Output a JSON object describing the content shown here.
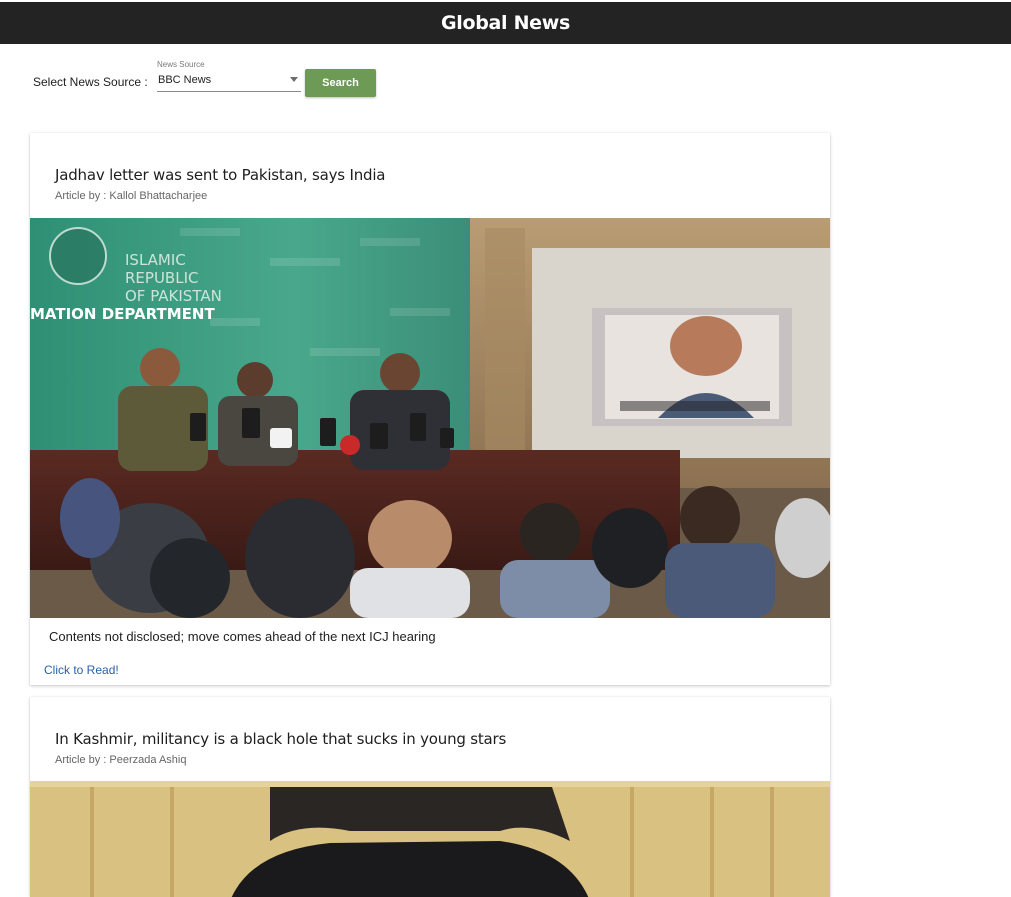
{
  "header": {
    "title": "Global News"
  },
  "toolbar": {
    "select_label": "Select News Source :",
    "source_field_label": "News Source",
    "source_value": "BBC News",
    "search_label": "Search"
  },
  "articles": [
    {
      "title": "Jadhav letter was sent to Pakistan, says India",
      "author": "Article by : Kallol Bhattacharjee",
      "description": "Contents not disclosed; move comes ahead of the next ICJ hearing",
      "read_link": "Click to Read!",
      "image_text": {
        "sign_line1": "ISLAMIC",
        "sign_line2": "REPUBLIC",
        "sign_line3": "OF PAKISTAN",
        "sign_line4": "MATION DEPARTMENT"
      }
    },
    {
      "title": "In Kashmir, militancy is a black hole that sucks in young stars",
      "author": "Article by : Peerzada Ashiq"
    }
  ],
  "colors": {
    "header_bg": "#232323",
    "search_button": "#6d9a55",
    "link": "#2b5fa8"
  }
}
